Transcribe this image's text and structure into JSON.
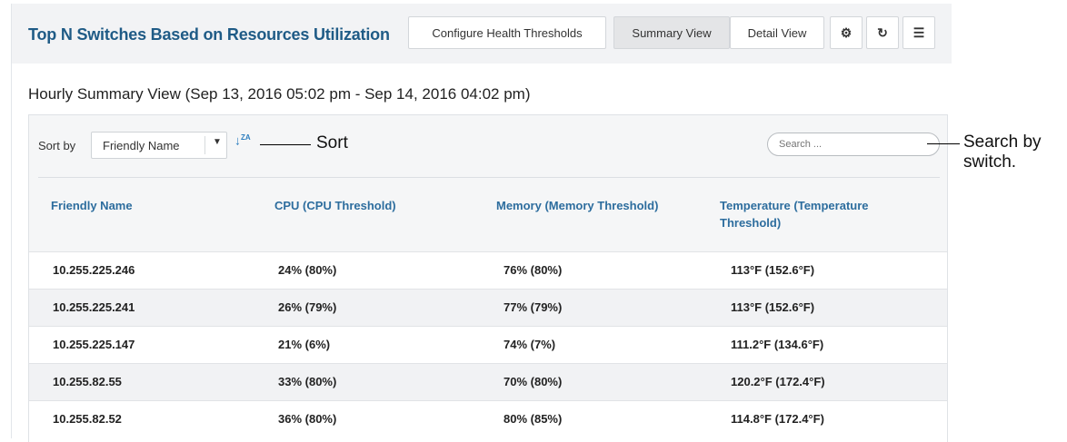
{
  "header": {
    "title": "Top N Switches Based on Resources Utilization",
    "configure_label": "Configure Health Thresholds",
    "summary_view_label": "Summary View",
    "detail_view_label": "Detail View",
    "icons": [
      "gear-icon",
      "refresh-icon",
      "menu-icon"
    ]
  },
  "subtitle": "Hourly Summary View (Sep 13, 2016 05:02 pm - Sep 14, 2016 04:02 pm)",
  "toolbar": {
    "sort_label": "Sort by",
    "sort_value": "Friendly Name",
    "search_placeholder": "Search ..."
  },
  "table": {
    "columns": [
      "Friendly Name",
      "CPU (CPU Threshold)",
      "Memory (Memory Threshold)",
      "Temperature (Temperature Threshold)"
    ],
    "rows": [
      [
        "10.255.225.246",
        "24% (80%)",
        "76% (80%)",
        "113°F (152.6°F)"
      ],
      [
        "10.255.225.241",
        "26% (79%)",
        "77% (79%)",
        "113°F (152.6°F)"
      ],
      [
        "10.255.225.147",
        "21% (6%)",
        "74% (7%)",
        "111.2°F (134.6°F)"
      ],
      [
        "10.255.82.55",
        "33% (80%)",
        "70% (80%)",
        "120.2°F (172.4°F)"
      ],
      [
        "10.255.82.52",
        "36% (80%)",
        "80% (85%)",
        "114.8°F (172.4°F)"
      ]
    ]
  },
  "callouts": {
    "sort": "Sort",
    "search_line1": "Search by",
    "search_line2": "switch."
  },
  "colors": {
    "title": "#1f5b86",
    "column_header": "#2d6d9e",
    "sort_icon": "#2f7fbf"
  }
}
